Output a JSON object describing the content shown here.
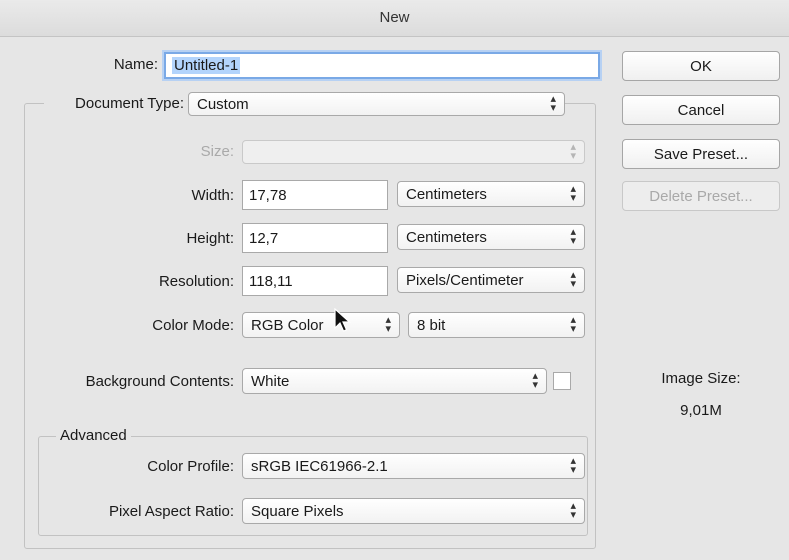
{
  "window": {
    "title": "New"
  },
  "name": {
    "label": "Name:",
    "value": "Untitled-1"
  },
  "document_type": {
    "label": "Document Type:",
    "value": "Custom"
  },
  "size": {
    "label": "Size:",
    "value": ""
  },
  "width": {
    "label": "Width:",
    "value": "17,78",
    "unit": "Centimeters"
  },
  "height": {
    "label": "Height:",
    "value": "12,7",
    "unit": "Centimeters"
  },
  "resolution": {
    "label": "Resolution:",
    "value": "118,11",
    "unit": "Pixels/Centimeter"
  },
  "color_mode": {
    "label": "Color Mode:",
    "value": "RGB Color",
    "depth": "8 bit"
  },
  "background": {
    "label": "Background Contents:",
    "value": "White",
    "swatch_color": "#ffffff"
  },
  "advanced": {
    "legend": "Advanced",
    "color_profile": {
      "label": "Color Profile:",
      "value": "sRGB IEC61966-2.1"
    },
    "pixel_aspect": {
      "label": "Pixel Aspect Ratio:",
      "value": "Square Pixels"
    }
  },
  "buttons": {
    "ok": "OK",
    "cancel": "Cancel",
    "save_preset": "Save Preset...",
    "delete_preset": "Delete Preset..."
  },
  "image_size": {
    "label": "Image Size:",
    "value": "9,01M"
  },
  "icons": {
    "popup_arrows": "updown-chevron-icon",
    "cursor": "mouse-pointer-icon"
  }
}
